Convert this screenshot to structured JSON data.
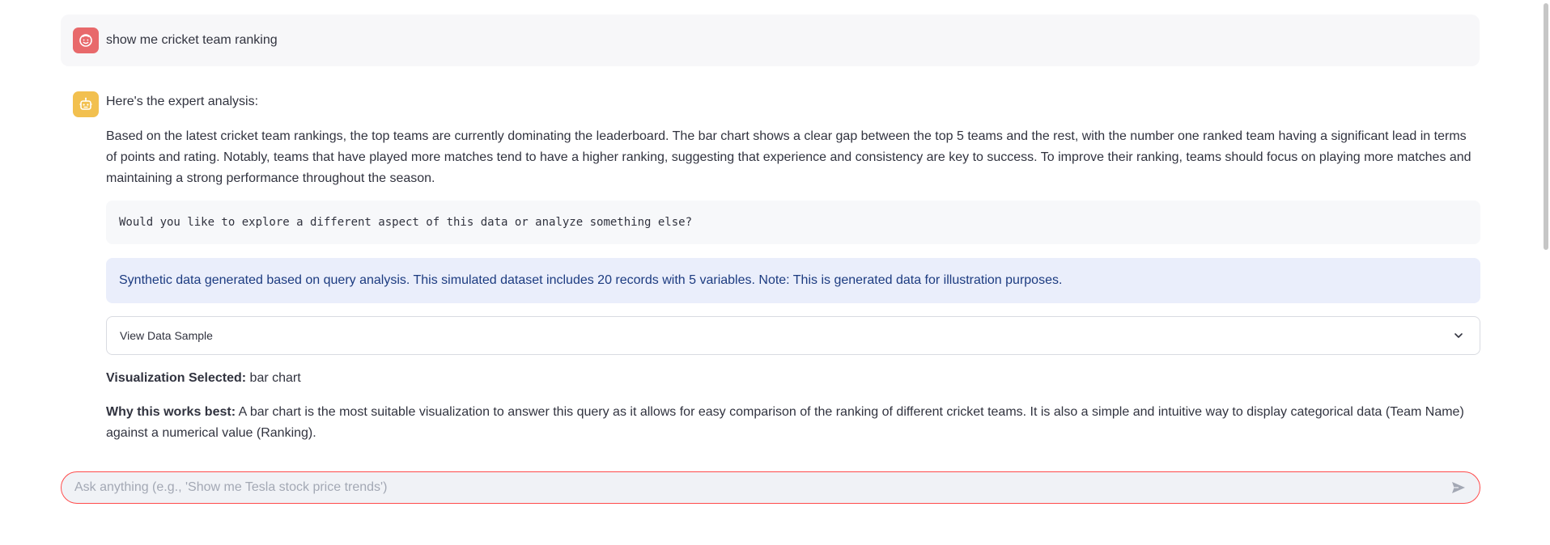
{
  "user_message": {
    "text": "show me cricket team ranking",
    "avatar_icon": "user-face-icon",
    "avatar_color": "#e8696b"
  },
  "assistant_message": {
    "avatar_icon": "robot-icon",
    "avatar_color": "#f2c04f",
    "heading": "Here's the expert analysis:",
    "analysis": "Based on the latest cricket team rankings, the top teams are currently dominating the leaderboard. The bar chart shows a clear gap between the top 5 teams and the rest, with the number one ranked team having a significant lead in terms of points and rating. Notably, teams that have played more matches tend to have a higher ranking, suggesting that experience and consistency are key to success. To improve their ranking, teams should focus on playing more matches and maintaining a strong performance throughout the season.",
    "follow_up_code": "Would you like to explore a different aspect of this data or analyze something else?",
    "info_note": "Synthetic data generated based on query analysis. This simulated dataset includes 20 records with 5 variables. Note: This is generated data for illustration purposes.",
    "expander_label": "View Data Sample",
    "viz_selected_label": "Visualization Selected:",
    "viz_selected_value": "bar chart",
    "why_label": "Why this works best:",
    "why_text": "A bar chart is the most suitable visualization to answer this query as it allows for easy comparison of the ranking of different cricket teams. It is also a simple and intuitive way to display categorical data (Team Name) against a numerical value (Ranking)."
  },
  "chat_input": {
    "placeholder": "Ask anything (e.g., 'Show me Tesla stock price trends')",
    "value": "",
    "send_icon": "send-icon",
    "border_color": "#ff4b4b"
  },
  "colors": {
    "info_bg": "#eaeefb",
    "info_text": "#1c3b80"
  }
}
